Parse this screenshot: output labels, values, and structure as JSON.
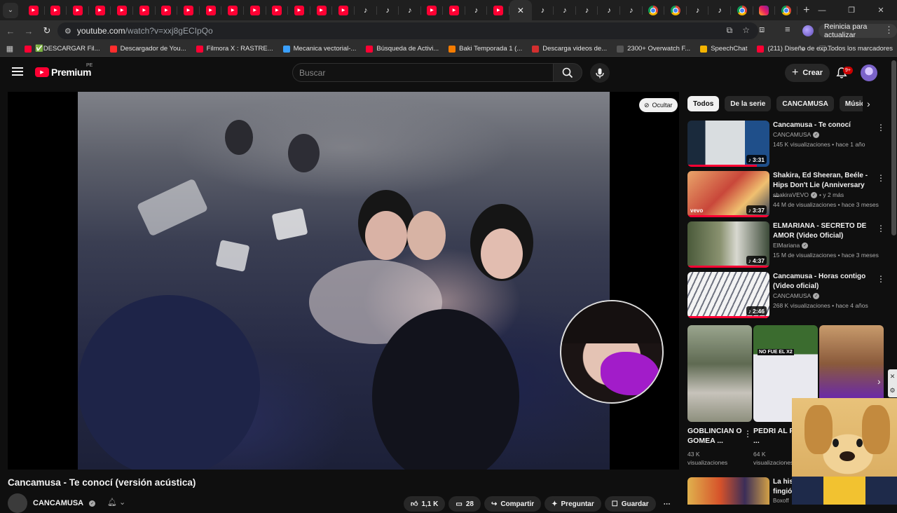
{
  "browser": {
    "tabs": [
      {
        "icon": "youtube"
      },
      {
        "icon": "youtube"
      },
      {
        "icon": "youtube"
      },
      {
        "icon": "youtube"
      },
      {
        "icon": "youtube"
      },
      {
        "icon": "youtube"
      },
      {
        "icon": "youtube"
      },
      {
        "icon": "youtube"
      },
      {
        "icon": "youtube"
      },
      {
        "icon": "youtube"
      },
      {
        "icon": "youtube"
      },
      {
        "icon": "youtube"
      },
      {
        "icon": "youtube"
      },
      {
        "icon": "youtube"
      },
      {
        "icon": "youtube"
      },
      {
        "icon": "tiktok"
      },
      {
        "icon": "tiktok"
      },
      {
        "icon": "tiktok"
      },
      {
        "icon": "youtube"
      },
      {
        "icon": "youtube"
      },
      {
        "icon": "tiktok"
      },
      {
        "icon": "youtube"
      },
      {
        "icon": "close",
        "active": true
      },
      {
        "icon": "tiktok"
      },
      {
        "icon": "tiktok"
      },
      {
        "icon": "tiktok"
      },
      {
        "icon": "tiktok"
      },
      {
        "icon": "tiktok"
      },
      {
        "icon": "chrome"
      },
      {
        "icon": "chrome"
      },
      {
        "icon": "tiktok"
      },
      {
        "icon": "tiktok"
      },
      {
        "icon": "chrome"
      },
      {
        "icon": "instagram"
      },
      {
        "icon": "chrome"
      }
    ],
    "url_host": "youtube.com",
    "url_path": "/watch?v=xxj8gECIpQo",
    "restart_label": "Reinicia para actualizar",
    "bookmarks": [
      {
        "label": "✅DESCARGAR Fil...",
        "color": "#ff0033"
      },
      {
        "label": "Descargador de You...",
        "color": "#ff2d2d"
      },
      {
        "label": "Filmora X : RASTRE...",
        "color": "#ff0033"
      },
      {
        "label": "Mecanica vectorial-...",
        "color": "#3aa0ff"
      },
      {
        "label": "Búsqueda de Activi...",
        "color": "#ff0033"
      },
      {
        "label": "Baki Temporada 1 (...",
        "color": "#f57c00"
      },
      {
        "label": "Descarga videos de...",
        "color": "#d32f2f"
      },
      {
        "label": "2300+ Overwatch F...",
        "color": "#555555"
      },
      {
        "label": "SpeechChat",
        "color": "#f4b400"
      },
      {
        "label": "(211) Diseño de exp...",
        "color": "#ff0033"
      }
    ],
    "all_bookmarks_label": "Todos los marcadores"
  },
  "masthead": {
    "logo_text": "Premium",
    "country_code": "PE",
    "search_placeholder": "Buscar",
    "create_label": "Crear",
    "notifications_badge": "9+"
  },
  "player": {
    "hide_label": "Ocultar"
  },
  "video": {
    "title": "Cancamusa - Te conocí (versión acústica)",
    "channel": "CANCAMUSA",
    "likes": "1,1 K",
    "comments": "28",
    "share_label": "Compartir",
    "ask_label": "Preguntar",
    "save_label": "Guardar"
  },
  "sidebar": {
    "chips": [
      "Todos",
      "De la serie",
      "CANCAMUSA",
      "Música"
    ],
    "recommendations": [
      {
        "title_1": "Cancamusa - Te conocí",
        "title_2": "",
        "channel": "CANCAMUSA",
        "meta": "145 K visualizaciones • hace 1 año",
        "duration": "3:31",
        "progress": 0.85
      },
      {
        "title_1": "Shakira, Ed Sheeran, Beéle -",
        "title_2": "Hips Don't Lie (Anniversary ...",
        "channel": "shakiraVEVO",
        "channel_suffix": "• y 2 más",
        "meta": "44 M de visualizaciones • hace 3 meses",
        "duration": "3:37",
        "progress": 1.0,
        "vevo": "vevo"
      },
      {
        "title_1": "ELMARIANA - SECRETO DE",
        "title_2": "AMOR (Video Oficial)",
        "channel": "ElMariana",
        "meta": "15 M de visualizaciones • hace 3 meses",
        "duration": "4:37",
        "progress": 1.0
      },
      {
        "title_1": "Cancamusa - Horas contigo",
        "title_2": "(Video oficial)",
        "channel": "CANCAMUSA",
        "meta": "268 K visualizaciones • hace 4 años",
        "duration": "2:46",
        "progress": 1.0
      }
    ],
    "shorts": [
      {
        "title": "GOBLINCIAN O GOMEA ...",
        "views": "43 K",
        "views_label": "visualizaciones",
        "thumb_text": ""
      },
      {
        "title": "PEDRI AL REAL ...",
        "views": "64 K",
        "views_label": "visualizaciones",
        "thumb_text": "NO FUE EL X2"
      },
      {
        "title": "",
        "views": "",
        "views_label": "",
        "thumb_text": ""
      }
    ],
    "last": {
      "title_1": "La his",
      "title_2": "fingió",
      "meta": "Boxoff"
    }
  }
}
